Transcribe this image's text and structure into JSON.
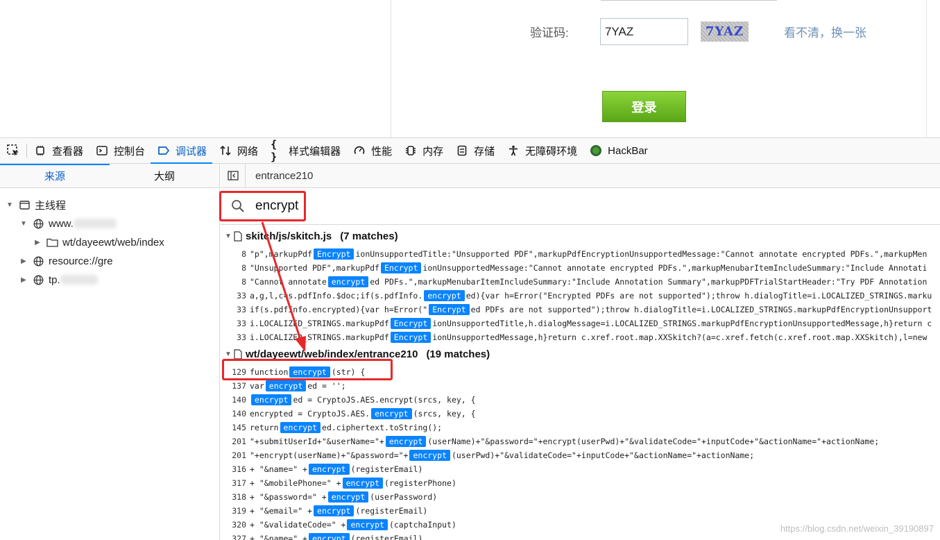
{
  "page": {
    "captcha_label": "验证码:",
    "captcha_value": "7YAZ",
    "captcha_image_text": "7YAZ",
    "captcha_refresh": "看不清，换一张",
    "login_button": "登录"
  },
  "toolbar": {
    "tabs": [
      "查看器",
      "控制台",
      "调试器",
      "网络",
      "样式编辑器",
      "性能",
      "内存",
      "存储",
      "无障碍环境",
      "HackBar"
    ]
  },
  "left": {
    "tabs": [
      "来源",
      "大纲"
    ],
    "tree": {
      "main_thread": "主线程",
      "host1": "www.",
      "folder": "wt/dayeewt/web/index",
      "resource": "resource://gre",
      "host2": "tp."
    }
  },
  "right": {
    "source_tab": "entrance210",
    "search_value": "encrypt",
    "files": [
      {
        "path": "skitch/js/skitch.js",
        "count": "(7 matches)"
      },
      {
        "path": "wt/dayeewt/web/index/entrance210",
        "count": "(19 matches)"
      }
    ],
    "file1_lines": [
      {
        "ln": "8",
        "pre": "\"p\",markupPdf",
        "hl": "Encrypt",
        "post": "ionUnsupportedTitle:\"Unsupported PDF\",markupPdfEncryptionUnsupportedMessage:\"Cannot annotate encrypted PDFs.\",markupMen"
      },
      {
        "ln": "8",
        "pre": "\"Unsupported PDF\",markupPdf",
        "hl": "Encrypt",
        "post": "ionUnsupportedMessage:\"Cannot annotate encrypted PDFs.\",markupMenubarItemIncludeSummary:\"Include Annotati"
      },
      {
        "ln": "8",
        "pre": "\"Cannot annotate",
        "hl": "encrypt",
        "post": "ed PDFs.\",markupMenubarItemIncludeSummary:\"Include Annotation Summary\",markupPDFTrialStartHeader:\"Try PDF Annotation"
      },
      {
        "ln": "33",
        "pre": "a,g,l,c=s.pdfInfo.$doc;if(s.pdfInfo.",
        "hl": "encrypt",
        "post": "ed){var h=Error(\"Encrypted PDFs are not supported\");throw h.dialogTitle=i.LOCALIZED_STRINGS.marku"
      },
      {
        "ln": "33",
        "pre": "if(s.pdfInfo.encrypted){var h=Error(\"",
        "hl": "Encrypt",
        "post": "ed PDFs are not supported\");throw h.dialogTitle=i.LOCALIZED_STRINGS.markupPdfEncryptionUnsupport"
      },
      {
        "ln": "33",
        "pre": "i.LOCALIZED_STRINGS.markupPdf",
        "hl": "Encrypt",
        "post": "ionUnsupportedTitle,h.dialogMessage=i.LOCALIZED_STRINGS.markupPdfEncryptionUnsupportedMessage,h}return c"
      },
      {
        "ln": "33",
        "pre": "i.LOCALIZED_STRINGS.markupPdf",
        "hl": "Encrypt",
        "post": "ionUnsupportedMessage,h}return c.xref.root.map.XXSkitch?(a=c.xref.fetch(c.xref.root.map.XXSkitch),l=new"
      }
    ],
    "file2_lines": [
      {
        "ln": "129",
        "pre": "function",
        "hl": "encrypt",
        "post": "(str) {"
      },
      {
        "ln": "137",
        "pre": "var",
        "hl": "encrypt",
        "post": "ed = '';"
      },
      {
        "ln": "140",
        "pre": "",
        "hl": "encrypt",
        "post": "ed = CryptoJS.AES.encrypt(srcs, key, {"
      },
      {
        "ln": "140",
        "pre": "encrypted = CryptoJS.AES.",
        "hl": "encrypt",
        "post": "(srcs, key, {"
      },
      {
        "ln": "145",
        "pre": "return",
        "hl": "encrypt",
        "post": "ed.ciphertext.toString();"
      },
      {
        "ln": "201",
        "pre": "\"+submitUserId+\"&userName=\"+",
        "hl": "encrypt",
        "post": "(userName)+\"&password=\"+encrypt(userPwd)+\"&validateCode=\"+inputCode+\"&actionName=\"+actionName;"
      },
      {
        "ln": "201",
        "pre": "\"+encrypt(userName)+\"&password=\"+",
        "hl": "encrypt",
        "post": "(userPwd)+\"&validateCode=\"+inputCode+\"&actionName=\"+actionName;"
      },
      {
        "ln": "316",
        "pre": "+ \"&name=\" +",
        "hl": "encrypt",
        "post": "(registerEmail)"
      },
      {
        "ln": "317",
        "pre": "+ \"&mobilePhone=\" +",
        "hl": "encrypt",
        "post": "(registerPhone)"
      },
      {
        "ln": "318",
        "pre": "+ \"&password=\" +",
        "hl": "encrypt",
        "post": "(userPassword)"
      },
      {
        "ln": "319",
        "pre": "+ \"&email=\" +",
        "hl": "encrypt",
        "post": "(registerEmail)"
      },
      {
        "ln": "320",
        "pre": "+ \"&validateCode=\" +",
        "hl": "encrypt",
        "post": "(captchaInput)"
      },
      {
        "ln": "327",
        "pre": "+ \"&name=\" +",
        "hl": "encrypt",
        "post": "(registerEmail)"
      }
    ]
  },
  "watermark": "https://blog.csdn.net/weixin_39190897",
  "colors": {
    "accent": "#0a84ff",
    "annotation": "#e6282c",
    "login_green": "#6cbd22"
  }
}
